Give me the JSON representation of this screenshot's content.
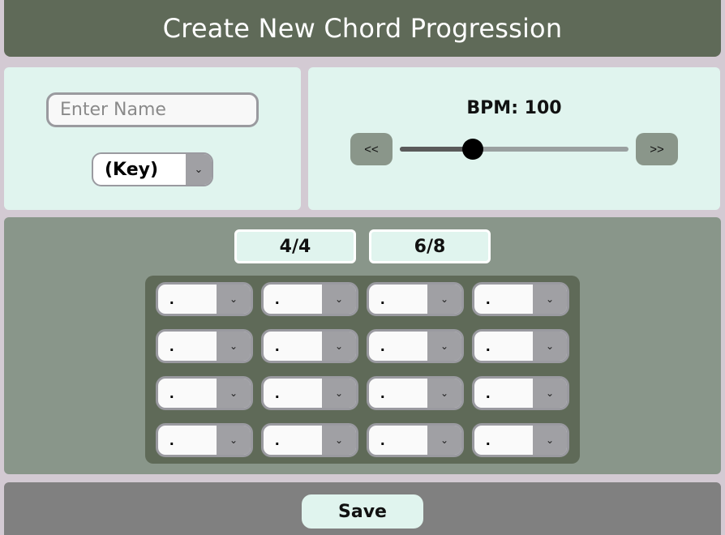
{
  "header": {
    "title": "Create New Chord Progression"
  },
  "name_field": {
    "placeholder": "Enter Name",
    "value": ""
  },
  "key_select": {
    "value": "(Key)",
    "icon": "chevron-down-icon"
  },
  "tempo": {
    "label": "BPM: 100",
    "bpm": 100,
    "slider_level": 0.32,
    "decrease_label": "<<",
    "increase_label": ">>"
  },
  "time_signatures": [
    {
      "label": "4/4"
    },
    {
      "label": "6/8"
    }
  ],
  "chord_grid": {
    "rows": [
      [
        ".",
        ".",
        ".",
        "."
      ],
      [
        ".",
        ".",
        ".",
        "."
      ],
      [
        ".",
        ".",
        ".",
        "."
      ],
      [
        ".",
        ".",
        ".",
        "."
      ]
    ]
  },
  "footer": {
    "save_label": "Save"
  },
  "colors": {
    "header": "#5f6a58",
    "panel_light": "#e0f4ee",
    "panel_mid": "#89968a",
    "grid_bg": "#5f6a58",
    "footer": "#808080"
  }
}
